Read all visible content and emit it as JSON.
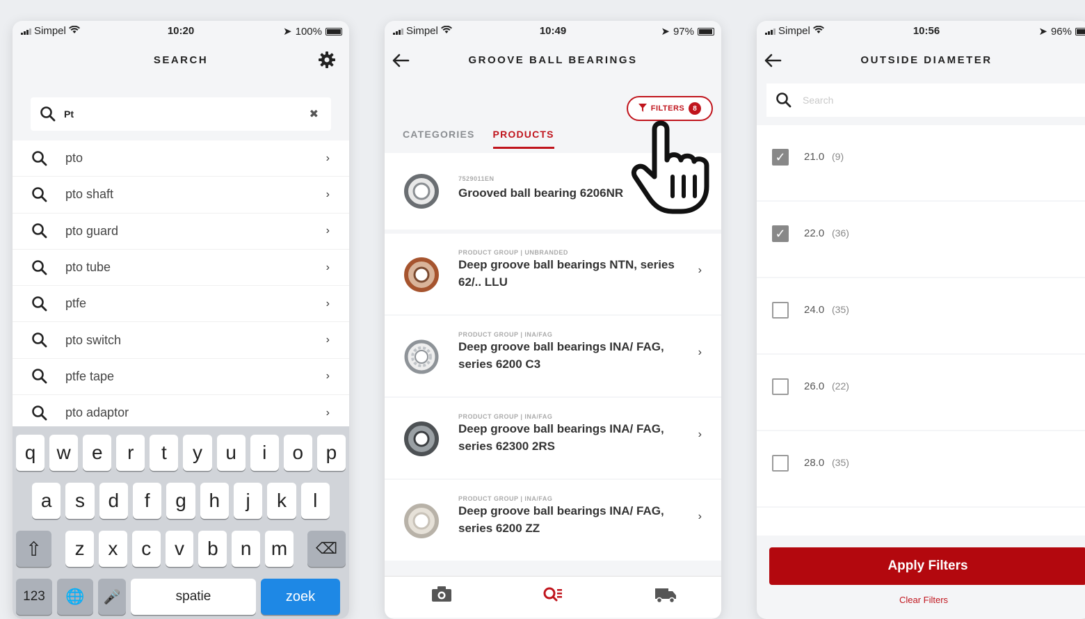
{
  "screen1": {
    "status": {
      "carrier": "Simpel",
      "time": "10:20",
      "battery": "100%"
    },
    "title": "SEARCH",
    "search_value": "Pt",
    "suggestions": [
      "pto",
      "pto shaft",
      "pto guard",
      "pto tube",
      "ptfe",
      "pto switch",
      "ptfe tape",
      "pto adaptor"
    ],
    "keyboard": {
      "row1": [
        "q",
        "w",
        "e",
        "r",
        "t",
        "y",
        "u",
        "i",
        "o",
        "p"
      ],
      "row2": [
        "a",
        "s",
        "d",
        "f",
        "g",
        "h",
        "j",
        "k",
        "l"
      ],
      "row3": [
        "z",
        "x",
        "c",
        "v",
        "b",
        "n",
        "m"
      ],
      "numbers_key": "123",
      "space_key": "spatie",
      "go_key": "zoek"
    }
  },
  "screen2": {
    "status": {
      "carrier": "Simpel",
      "time": "10:49",
      "battery": "97%"
    },
    "title": "GROOVE BALL BEARINGS",
    "filter_button": {
      "label": "FILTERS",
      "count": "8"
    },
    "tabs": [
      {
        "label": "CATEGORIES",
        "active": false
      },
      {
        "label": "PRODUCTS",
        "active": true
      }
    ],
    "products": [
      {
        "meta": "7529011EN",
        "name": "Grooved ball bearing 6206NR",
        "ring_color": "#6a6e72"
      },
      {
        "meta": "PRODUCT GROUP | UNBRANDED",
        "name": "Deep groove ball bearings NTN, series 62/.. LLU",
        "ring_color": "#a6542e"
      },
      {
        "meta": "PRODUCT GROUP | INA/FAG",
        "name": "Deep groove ball bearings INA/ FAG, series 6200 C3",
        "ring_color": "#8e9398"
      },
      {
        "meta": "PRODUCT GROUP | INA/FAG",
        "name": "Deep groove ball bearings INA/ FAG, series 62300 2RS",
        "ring_color": "#4d5154"
      },
      {
        "meta": "PRODUCT GROUP | INA/FAG",
        "name": "Deep groove ball bearings INA/ FAG, series 6200 ZZ",
        "ring_color": "#b8b2a8"
      }
    ]
  },
  "screen3": {
    "status": {
      "carrier": "Simpel",
      "time": "10:56",
      "battery": "96%"
    },
    "title": "OUTSIDE DIAMETER",
    "search_placeholder": "Search",
    "options": [
      {
        "value": "21.0",
        "count": "(9)",
        "checked": true
      },
      {
        "value": "22.0",
        "count": "(36)",
        "checked": true
      },
      {
        "value": "24.0",
        "count": "(35)",
        "checked": false
      },
      {
        "value": "26.0",
        "count": "(22)",
        "checked": false
      },
      {
        "value": "28.0",
        "count": "(35)",
        "checked": false
      }
    ],
    "apply_label": "Apply Filters",
    "clear_label": "Clear Filters"
  },
  "colors": {
    "accent": "#c0141c",
    "apply": "#b3080e",
    "keyboard_go": "#1e88e5"
  }
}
